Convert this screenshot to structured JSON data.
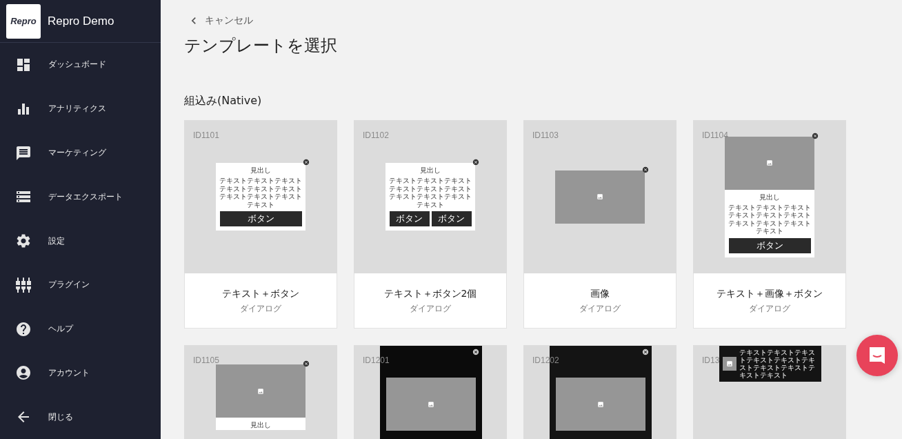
{
  "sidebar": {
    "logo": "Repro",
    "app_name": "Repro Demo",
    "items": [
      {
        "label": "ダッシュボード"
      },
      {
        "label": "アナリティクス"
      },
      {
        "label": "マーケティング"
      },
      {
        "label": "データエクスポート"
      },
      {
        "label": "設定"
      },
      {
        "label": "プラグイン"
      },
      {
        "label": "ヘルプ"
      },
      {
        "label": "アカウント"
      },
      {
        "label": "閉じる"
      }
    ]
  },
  "back_link": "キャンセル",
  "title": "テンプレートを選択",
  "section": "組込み(Native)",
  "cards": [
    {
      "id": "ID1101",
      "title": "テキスト＋ボタン",
      "subtitle": "ダイアログ",
      "preview": {
        "kind": "dialog",
        "heading": "見出し",
        "body": "テキストテキストテキストテキストテキストテキストテキストテキストテキストテキスト",
        "buttons": [
          "ボタン"
        ]
      }
    },
    {
      "id": "ID1102",
      "title": "テキスト＋ボタン2個",
      "subtitle": "ダイアログ",
      "preview": {
        "kind": "dialog",
        "heading": "見出し",
        "body": "テキストテキストテキストテキストテキストテキストテキストテキストテキストテキスト",
        "buttons": [
          "ボタン",
          "ボタン"
        ]
      }
    },
    {
      "id": "ID1103",
      "title": "画像",
      "subtitle": "ダイアログ",
      "preview": {
        "kind": "dialog",
        "image": true
      }
    },
    {
      "id": "ID1104",
      "title": "テキスト＋画像＋ボタン",
      "subtitle": "ダイアログ",
      "preview": {
        "kind": "dialog",
        "image": true,
        "heading": "見出し",
        "body": "テキストテキストテキストテキストテキストテキストテキストテキストテキストテキスト",
        "buttons": [
          "ボタン"
        ]
      }
    },
    {
      "id": "ID1105",
      "preview": {
        "kind": "dialog",
        "image": true,
        "heading": "見出し"
      }
    },
    {
      "id": "ID1201",
      "preview": {
        "kind": "fullscreen"
      }
    },
    {
      "id": "ID1202",
      "preview": {
        "kind": "fullscreen"
      }
    },
    {
      "id": "ID13",
      "preview": {
        "kind": "banner",
        "body": "テキストテキストテキストテキストテキストテキストテキストテキストテキストテキスト"
      }
    }
  ]
}
